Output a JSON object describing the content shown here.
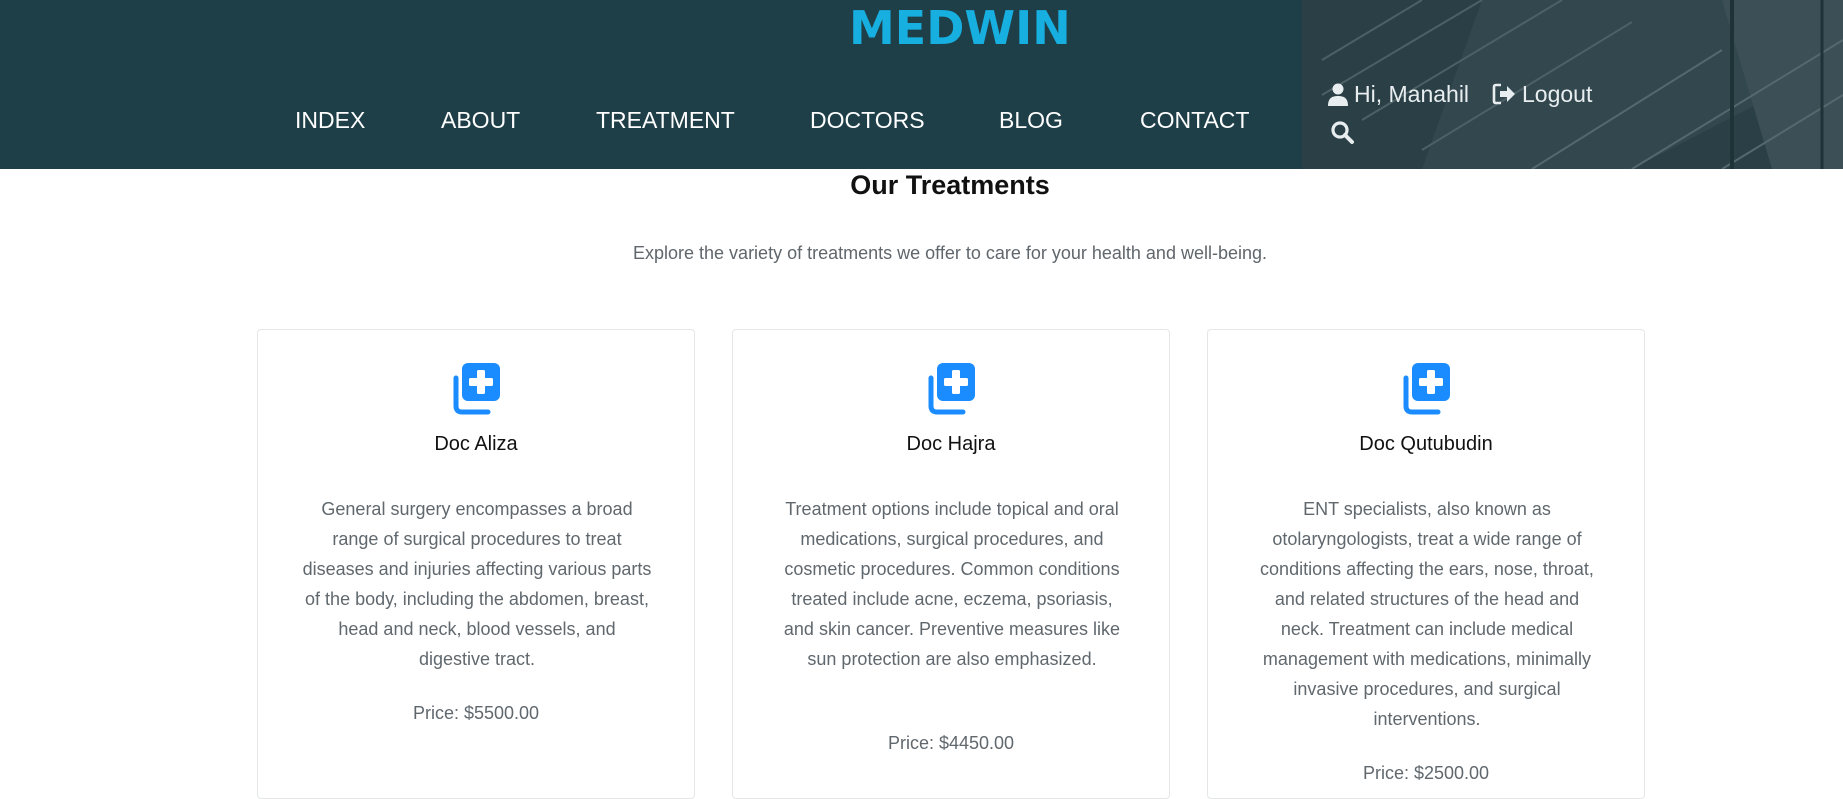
{
  "header": {
    "logo": "MEDWIN",
    "nav": [
      "INDEX",
      "ABOUT",
      "TREATMENT",
      "DOCTORS",
      "BLOG",
      "CONTACT"
    ],
    "user_greeting": "Hi, Manahil",
    "logout_label": "Logout",
    "icons": {
      "user": "user-icon",
      "logout": "sign-out-icon",
      "search": "search-icon"
    },
    "colors": {
      "background": "#1f3f48",
      "logo": "#17aee0"
    }
  },
  "section": {
    "title": "Our Treatments",
    "subtitle": "Explore the variety of treatments we offer to care for your health and well-being."
  },
  "cards": [
    {
      "icon": "medical-files-icon",
      "name": "Doc Aliza",
      "description": "General surgery encompasses a broad range of surgical procedures to treat diseases and injuries affecting various parts of the body, including the abdomen, breast, head and neck, blood vessels, and digestive tract.",
      "price": "Price: $5500.00"
    },
    {
      "icon": "medical-files-icon",
      "name": "Doc Hajra",
      "description": "Treatment options include topical and oral medications, surgical procedures, and cosmetic procedures. Common conditions treated include acne, eczema, psoriasis, and skin cancer. Preventive measures like sun protection are also emphasized.",
      "price": "Price: $4450.00"
    },
    {
      "icon": "medical-files-icon",
      "name": "Doc Qutubudin",
      "description": "ENT specialists, also known as otolaryngologists, treat a wide range of conditions affecting the ears, nose, throat, and related structures of the head and neck. Treatment can include medical management with medications, minimally invasive procedures, and surgical interventions.",
      "price": "Price: $2500.00"
    }
  ],
  "accent_color": "#1a8cff"
}
